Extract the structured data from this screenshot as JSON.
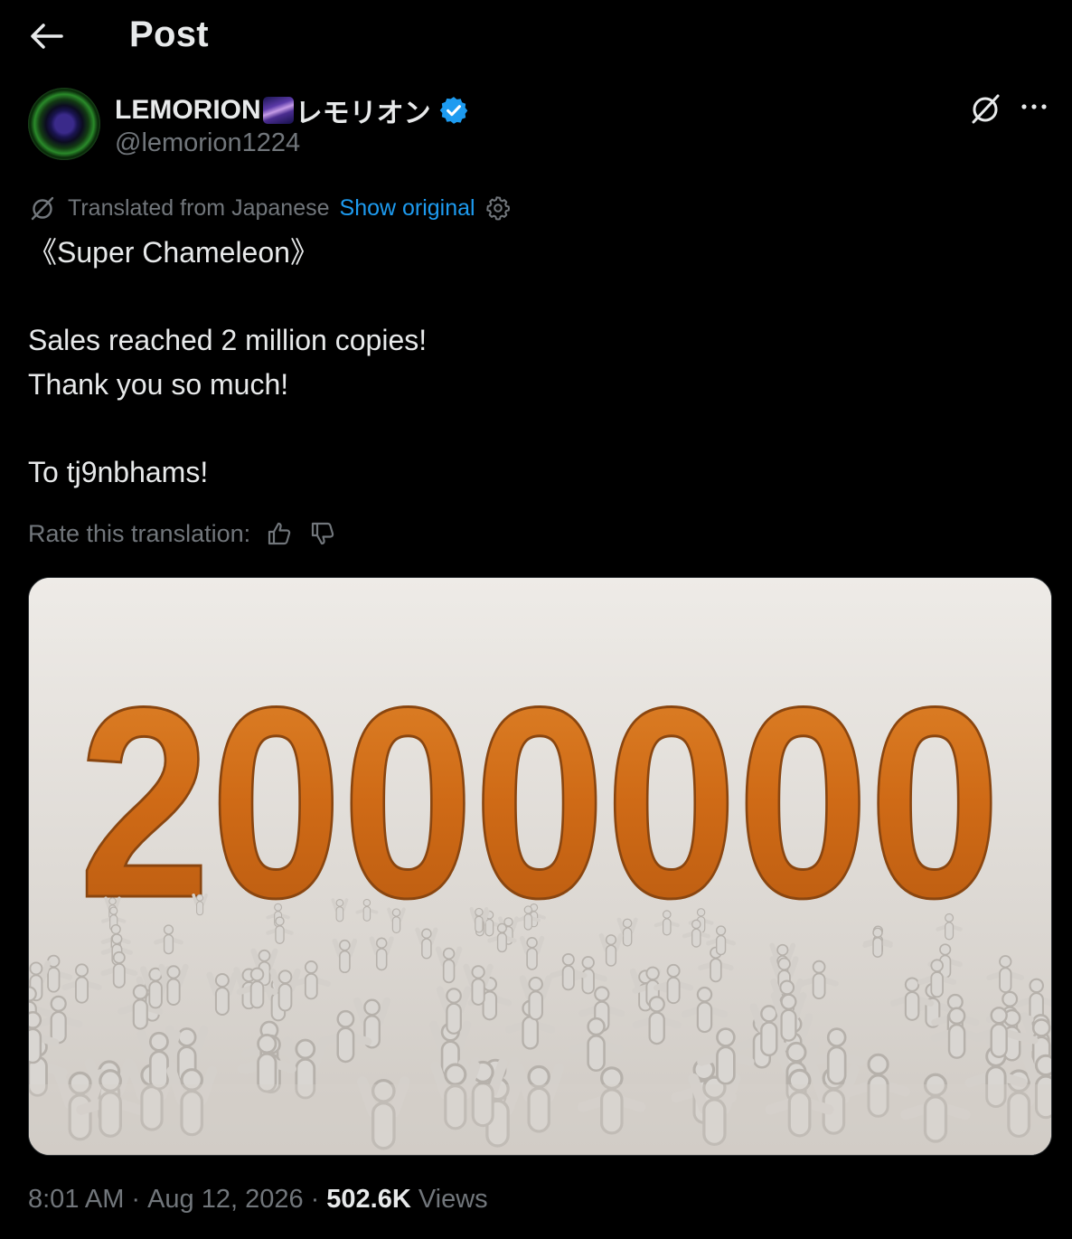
{
  "header": {
    "title": "Post",
    "back_icon": "arrow-left-icon"
  },
  "author": {
    "name": "LEMORION",
    "name_suffix": "レモリオン",
    "name_emoji": "milky-way-emoji",
    "handle": "@lemorion1224",
    "verified": true,
    "avatar_icon": "galaxy-ring-avatar"
  },
  "actions": {
    "grok_icon": "grok-icon",
    "more_icon": "more-dots-icon"
  },
  "translation": {
    "label": "Translated from Japanese",
    "show_original": "Show original",
    "settings_icon": "gear-icon",
    "rate_label": "Rate this translation:",
    "thumbs_up_icon": "thumbs-up-icon",
    "thumbs_down_icon": "thumbs-down-icon"
  },
  "post": {
    "text": "《Super Chameleon》\n\nSales reached 2 million copies!\nThank you so much!\n\nTo tj9nbhams!"
  },
  "media": {
    "number_text": "2000000"
  },
  "meta": {
    "time": "8:01 AM",
    "dot1": "·",
    "date": "Aug 12, 2026",
    "dot2": "·",
    "views_count": "502.6K",
    "views_label": "Views"
  },
  "colors": {
    "background": "#000000",
    "text": "#e7e9ea",
    "muted": "#71767b",
    "link": "#1d9bf0",
    "number_orange": "#d8741c"
  }
}
